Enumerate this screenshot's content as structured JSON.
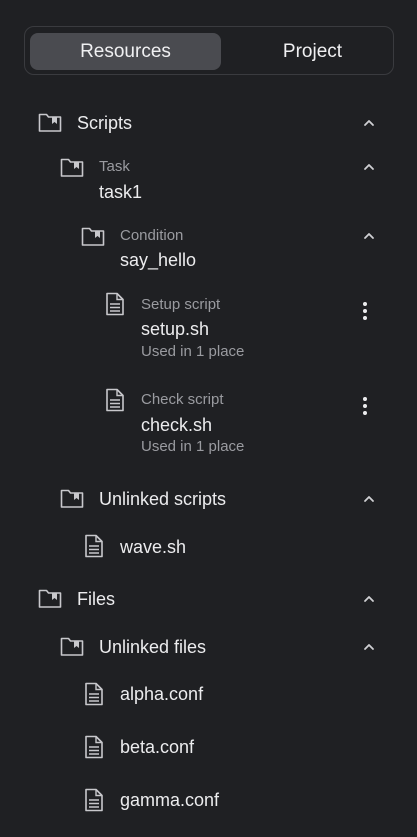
{
  "tabs": {
    "resources": "Resources",
    "project": "Project"
  },
  "tree": {
    "scripts": {
      "label": "Scripts",
      "task": {
        "type": "Task",
        "name": "task1",
        "condition": {
          "type": "Condition",
          "name": "say_hello",
          "setup": {
            "type": "Setup script",
            "name": "setup.sh",
            "usage": "Used in 1 place"
          },
          "check": {
            "type": "Check script",
            "name": "check.sh",
            "usage": "Used in 1 place"
          }
        }
      },
      "unlinked": {
        "label": "Unlinked scripts",
        "items": [
          "wave.sh"
        ]
      }
    },
    "files": {
      "label": "Files",
      "unlinked": {
        "label": "Unlinked files",
        "items": [
          "alpha.conf",
          "beta.conf",
          "gamma.conf"
        ]
      }
    }
  },
  "icons": {
    "folder": "folder-bookmark-icon",
    "file": "file-text-icon",
    "chevron": "chevron-up-icon",
    "more": "more-vertical-icon"
  },
  "colors": {
    "background": "#1f2023",
    "active_tab": "#4a4b50",
    "text_primary": "#ececee",
    "text_secondary": "#9a9ba0"
  }
}
